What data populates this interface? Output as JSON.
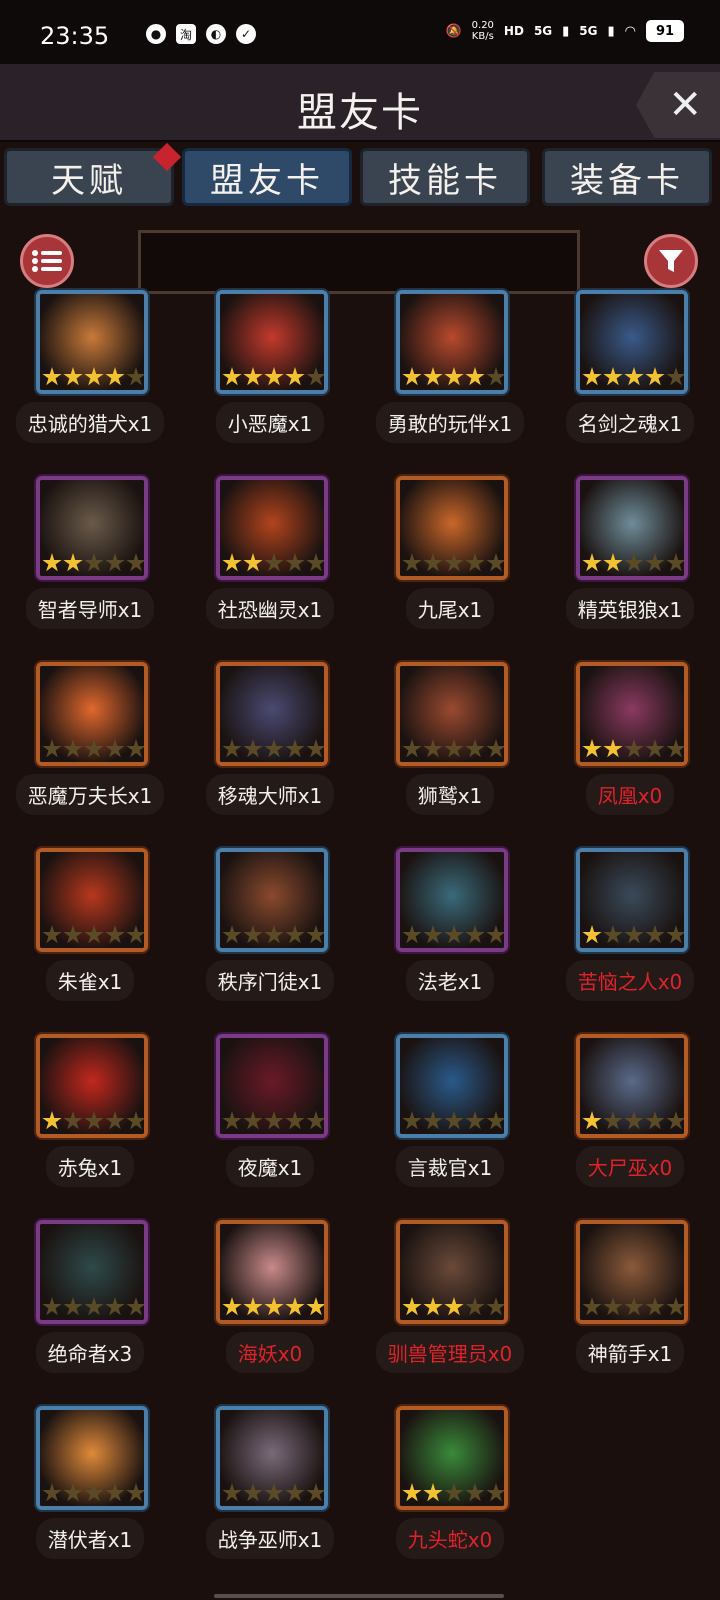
{
  "status_bar": {
    "time": "23:35",
    "left_icons": [
      "weibo-icon",
      "taobao-icon",
      "app-icon",
      "shield-icon"
    ],
    "net_speed": "0.20\nKB/s",
    "hd": "HD",
    "signal1": "5G",
    "signal2": "5G",
    "battery": "91"
  },
  "header": {
    "title": "盟友卡",
    "close_label": "✕"
  },
  "tabs": [
    {
      "label": "天赋",
      "badge": true
    },
    {
      "label": "盟友卡",
      "active": true
    },
    {
      "label": "技能卡"
    },
    {
      "label": "装备卡"
    }
  ],
  "search": {
    "placeholder": "",
    "value": ""
  },
  "cards": [
    {
      "name": "忠诚的猎犬x1",
      "stars": 4,
      "frame": "blue",
      "color": "#c87a3a",
      "owned": true
    },
    {
      "name": "小恶魔x1",
      "stars": 4,
      "frame": "blue",
      "color": "#c23a2c",
      "owned": true
    },
    {
      "name": "勇敢的玩伴x1",
      "stars": 4,
      "frame": "blue",
      "color": "#b84a2e",
      "owned": true
    },
    {
      "name": "名剑之魂x1",
      "stars": 4,
      "frame": "blue",
      "color": "#3a5a8a",
      "owned": true
    },
    {
      "name": "智者导师x1",
      "stars": 2,
      "frame": "purple",
      "color": "#6a5a4a",
      "owned": true
    },
    {
      "name": "社恐幽灵x1",
      "stars": 2,
      "frame": "purple",
      "color": "#b2441e",
      "owned": true
    },
    {
      "name": "九尾x1",
      "stars": 0,
      "frame": "orange",
      "color": "#c9672a",
      "owned": true
    },
    {
      "name": "精英银狼x1",
      "stars": 2,
      "frame": "purple",
      "color": "#6f8d9a",
      "owned": true
    },
    {
      "name": "恶魔万夫长x1",
      "stars": 0,
      "frame": "orange",
      "color": "#e0682e",
      "owned": true
    },
    {
      "name": "移魂大师x1",
      "stars": 0,
      "frame": "orange",
      "color": "#4a4a72",
      "owned": true
    },
    {
      "name": "狮鹫x1",
      "stars": 0,
      "frame": "orange",
      "color": "#9a4a30",
      "owned": true
    },
    {
      "name": "凤凰x0",
      "stars": 2,
      "frame": "orange",
      "color": "#8a3a60",
      "owned": false
    },
    {
      "name": "朱雀x1",
      "stars": 0,
      "frame": "orange",
      "color": "#b8381e",
      "owned": true
    },
    {
      "name": "秩序门徒x1",
      "stars": 0,
      "frame": "blue",
      "color": "#8a4a2e",
      "owned": true
    },
    {
      "name": "法老x1",
      "stars": 0,
      "frame": "purple",
      "color": "#3a6a7a",
      "owned": true
    },
    {
      "name": "苦恼之人x0",
      "stars": 1,
      "frame": "blue",
      "color": "#3a4a5a",
      "owned": false
    },
    {
      "name": "赤兔x1",
      "stars": 1,
      "frame": "orange",
      "color": "#c2281e",
      "owned": true
    },
    {
      "name": "夜魔x1",
      "stars": 0,
      "frame": "purple",
      "color": "#6a1a28",
      "owned": true
    },
    {
      "name": "言裁官x1",
      "stars": 0,
      "frame": "blue",
      "color": "#2a5a8a",
      "owned": true
    },
    {
      "name": "大尸巫x0",
      "stars": 1,
      "frame": "orange",
      "color": "#5a6a8a",
      "owned": false
    },
    {
      "name": "绝命者x3",
      "stars": 0,
      "frame": "purple",
      "color": "#2e4a4a",
      "owned": true
    },
    {
      "name": "海妖x0",
      "stars": 5,
      "frame": "orange",
      "color": "#c88a8a",
      "owned": false
    },
    {
      "name": "驯兽管理员x0",
      "stars": 3,
      "frame": "orange",
      "color": "#6a4a3a",
      "owned": false
    },
    {
      "name": "神箭手x1",
      "stars": 0,
      "frame": "orange",
      "color": "#8a5a3a",
      "owned": true
    },
    {
      "name": "潜伏者x1",
      "stars": 0,
      "frame": "blue",
      "color": "#e08a3a",
      "owned": true
    },
    {
      "name": "战争巫师x1",
      "stars": 0,
      "frame": "blue",
      "color": "#7a6a7a",
      "owned": true
    },
    {
      "name": "九头蛇x0",
      "stars": 2,
      "frame": "orange",
      "color": "#3a8a3a",
      "owned": false
    }
  ]
}
